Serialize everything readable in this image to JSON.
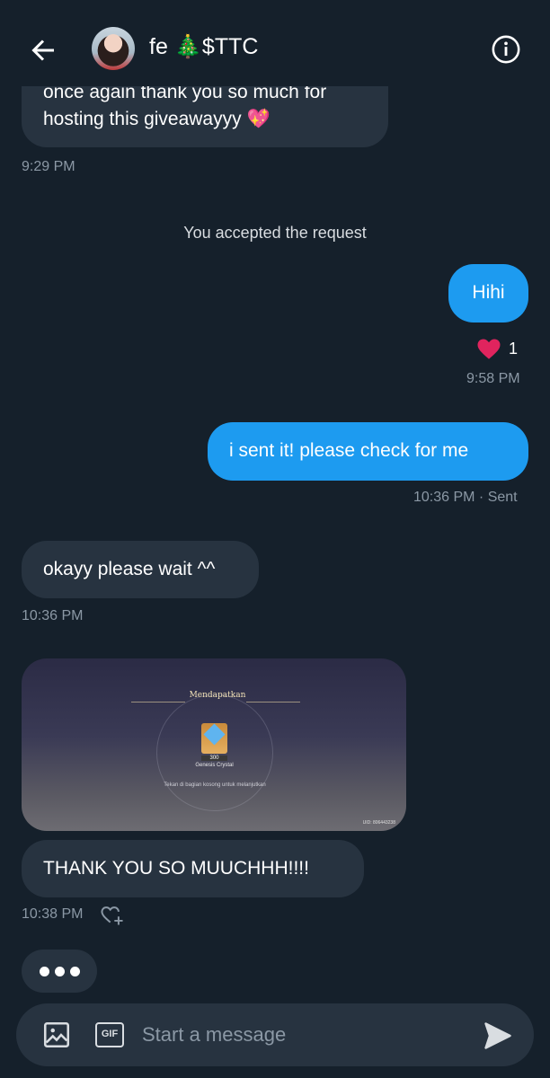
{
  "header": {
    "title": "fe 🎄$TTC"
  },
  "messages": {
    "m1_text": "once again thank you so much for hosting this giveawayyy 💖",
    "m1_time": "9:29 PM",
    "system_text": "You accepted the request",
    "m2_text": "Hihi",
    "m2_reaction_count": "1",
    "m2_time": "9:58 PM",
    "m3_text": "i sent it! please check for me",
    "m3_time": "10:36 PM · Sent",
    "m4_text": "okayy please wait ^^",
    "m4_time": "10:36 PM",
    "image": {
      "banner": "Mendapatkan",
      "item_qty": "300",
      "item_name": "Genesis Crystal",
      "tip": "Tekan di bagian kosong untuk melanjutkan",
      "uid": "UID: 806443238"
    },
    "m5_text": "THANK YOU SO MUUCHHH!!!!",
    "m5_time": "10:38 PM"
  },
  "composer": {
    "placeholder": "Start a message",
    "gif_label": "GIF"
  },
  "colors": {
    "background": "#15202b",
    "incoming_bubble": "#273340",
    "outgoing_bubble": "#1d9bf0",
    "muted_text": "#8b98a5",
    "heart": "#f91880"
  },
  "icons": [
    "back-arrow-icon",
    "info-icon",
    "heart-icon",
    "heart-plus-icon",
    "image-icon",
    "gif-icon",
    "send-icon"
  ]
}
